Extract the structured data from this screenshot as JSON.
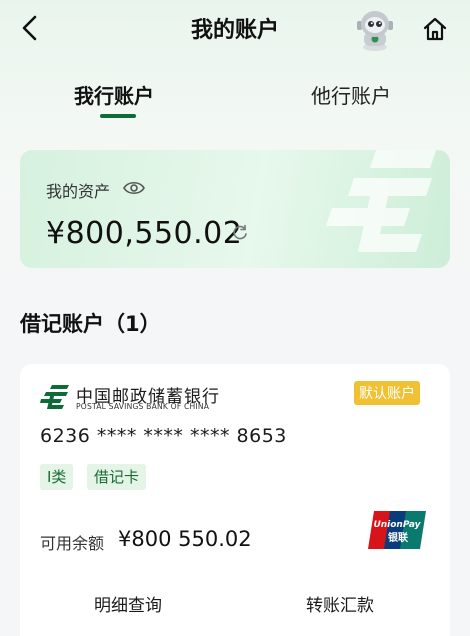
{
  "header": {
    "title": "我的账户",
    "back_icon": "chevron-left-icon",
    "assistant_icon": "robot-assistant-icon",
    "home_icon": "home-icon"
  },
  "tabs": [
    {
      "label": "我行账户",
      "active": true
    },
    {
      "label": "他行账户",
      "active": false
    }
  ],
  "assets": {
    "label": "我的资产",
    "amount": "¥800,550.02",
    "eye_icon": "eye-icon",
    "refresh_icon": "refresh-icon"
  },
  "section": {
    "title": "借记账户（1）"
  },
  "account": {
    "bank_name_cn": "中国邮政储蓄银行",
    "bank_name_en": "POSTAL SAVINGS BANK OF CHINA",
    "default_badge": "默认账户",
    "card_number": "6236 **** **** **** 8653",
    "tags": [
      "I类",
      "借记卡"
    ],
    "balance_label": "可用余额",
    "balance_value": "¥800 550.02",
    "card_network_icon": "unionpay-logo-icon",
    "actions": [
      "明细查询",
      "转账汇款"
    ]
  },
  "colors": {
    "brand_green": "#0d6b37",
    "badge_yellow": "#f2c033",
    "tag_bg": "#e4f4e7"
  }
}
